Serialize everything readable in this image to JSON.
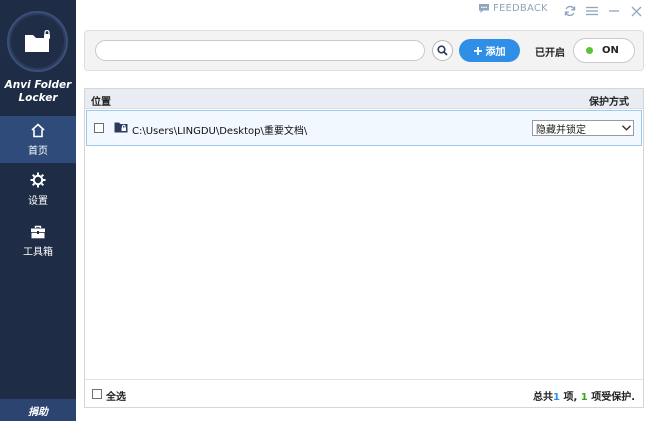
{
  "sidebar": {
    "app_name_line1": "Anvi Folder",
    "app_name_line2": "Locker",
    "logo_icon": "folder-lock-icon",
    "items": [
      {
        "label": "首页",
        "icon": "home-icon"
      },
      {
        "label": "设置",
        "icon": "gear-icon"
      },
      {
        "label": "工具箱",
        "icon": "toolbox-icon"
      }
    ],
    "donate_label": "捐助"
  },
  "titlebar": {
    "feedback_label": "FEEDBACK"
  },
  "toolbar": {
    "search_value": "",
    "search_placeholder": "",
    "add_label": "添加",
    "enabled_label": "已开启",
    "toggle_label": "ON"
  },
  "list": {
    "columns": [
      "位置",
      "保护方式"
    ],
    "rows": [
      {
        "path": "C:\\Users\\LINGDU\\Desktop\\重要文档\\",
        "protection": "隐藏并锁定"
      }
    ],
    "select_all_label": "全选",
    "summary": {
      "prefix": "总共",
      "total": "1",
      "mid": " 项, ",
      "protected": "1",
      "suffix": " 项受保护."
    }
  },
  "colors": {
    "sidebar_bg": "#1e2c45",
    "sidebar_active": "#2e4b7a",
    "accent_blue": "#2f8fe6",
    "toggle_green": "#5cc13a"
  }
}
